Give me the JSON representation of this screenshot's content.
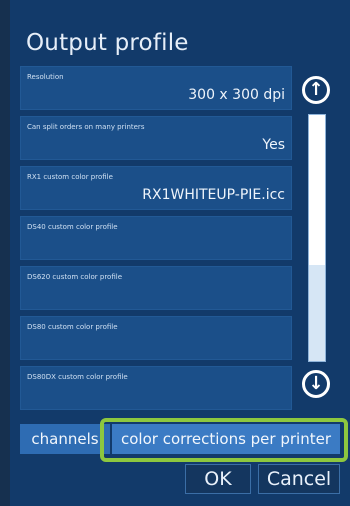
{
  "dialog": {
    "title": "Output profile"
  },
  "settings": [
    {
      "label": "Resolution",
      "value": "300 x 300 dpi"
    },
    {
      "label": "Can split orders on many printers",
      "value": "Yes"
    },
    {
      "label": "RX1 custom color profile",
      "value": "RX1WHITEUP-PIE.icc"
    },
    {
      "label": "DS40 custom color profile",
      "value": ""
    },
    {
      "label": "DS620 custom color profile",
      "value": ""
    },
    {
      "label": "DS80 custom color profile",
      "value": ""
    },
    {
      "label": "DS80DX custom color profile",
      "value": ""
    }
  ],
  "scroll": {
    "up_icon": "arrow-up-circle-icon",
    "down_icon": "arrow-down-circle-icon",
    "thumb_position_fraction": 0.0
  },
  "tabs": {
    "channels": "channels",
    "color_corrections": "color corrections per printer"
  },
  "buttons": {
    "ok": "OK",
    "cancel": "Cancel"
  },
  "colors": {
    "highlight": "#8dc73f",
    "accent": "#3b7bc4"
  }
}
